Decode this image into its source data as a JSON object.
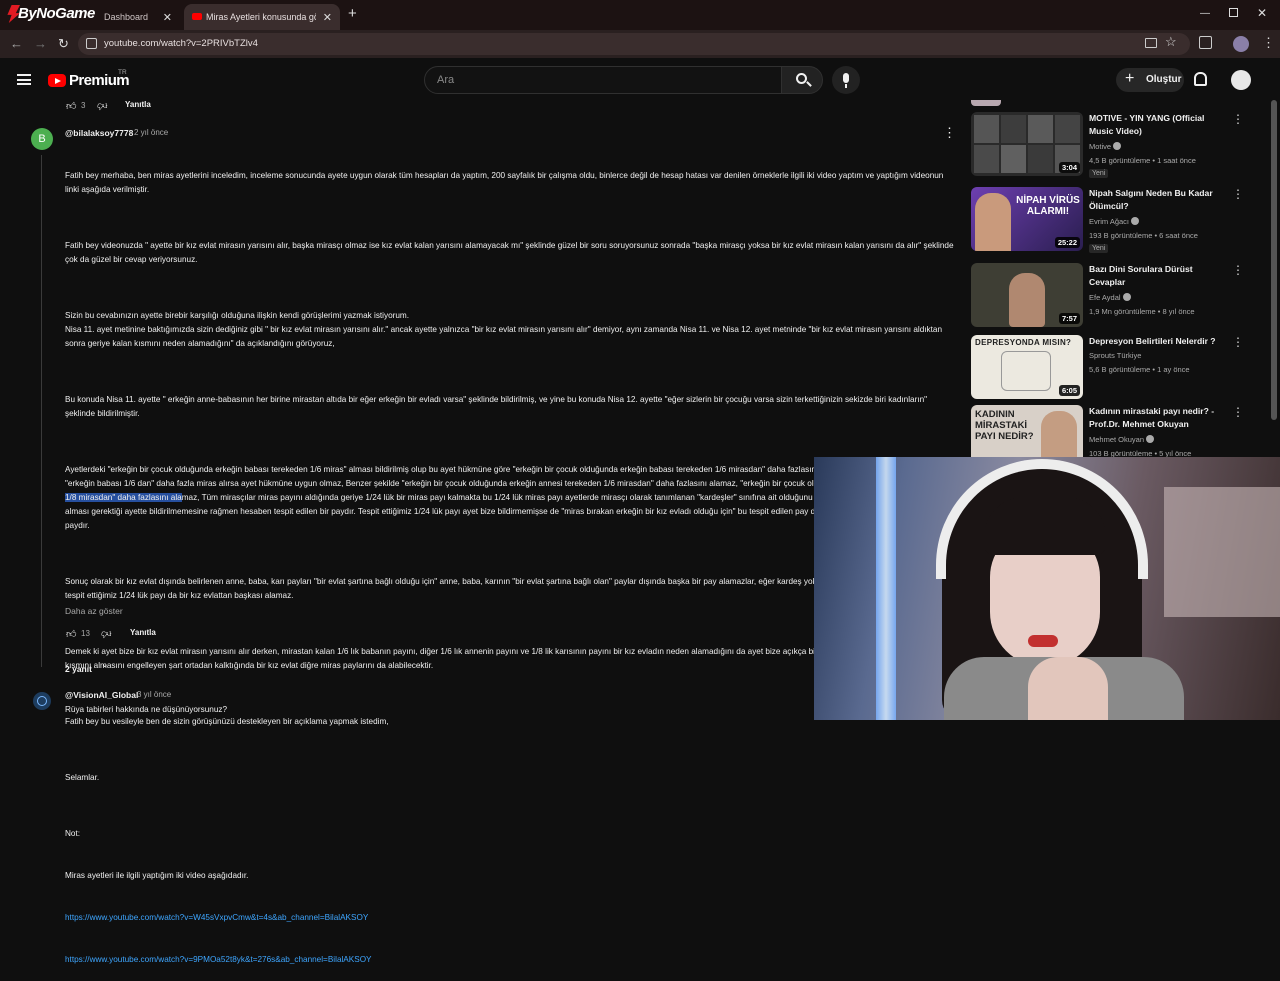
{
  "browser": {
    "brand": "ByNoGame",
    "tabs": [
      {
        "label": "Dashboard"
      },
      {
        "label": "Miras Ayetleri konusunda görüş"
      }
    ],
    "new_tab": "+",
    "url": "youtube.com/watch?v=2PRIVbTZlv4"
  },
  "youtube": {
    "logo": "Premium",
    "logo_sup": "TR",
    "search_placeholder": "Ara",
    "create_label": "Oluştur"
  },
  "prev_comment": {
    "likes": "3",
    "reply": "Yanıtla"
  },
  "comment": {
    "avatar_letter": "B",
    "author": "@bilalaksoy7778",
    "time": "2 yıl önce",
    "p1": "Fatih bey merhaba, ben miras ayetlerini inceledim, inceleme sonucunda ayete uygun olarak tüm hesapları da yaptım, 200 sayfalık bir çalışma oldu, binlerce değil de hesap hatası var denilen örneklerle ilgili iki video yaptım ve yaptığım videonun linki aşağıda verilmiştir.",
    "p2": "Fatih bey videonuzda \" ayette bir kız evlat mirasın yarısını alır, başka mirasçı olmaz ise kız evlat kalan yarısını alamayacak mı\" şeklinde güzel bir soru soruyorsunuz sonrada \"başka mirasçı yoksa bir kız evlat mirasın kalan yarısını da alır\" şeklinde çok da güzel bir cevap veriyorsunuz.",
    "p3": "Sizin bu cevabınızın ayette birebir karşılığı olduğuna ilişkin kendi görüşlerimi yazmak istiyorum.\nNisa 11. ayet metinine baktığımızda sizin dediğiniz gibi \" bir kız evlat mirasın yarısını alır.\" ancak ayette yalnızca \"bir kız evlat mirasın yarısını alır\" demiyor, aynı zamanda Nisa 11. ve Nisa 12. ayet metninde \"bir kız evlat mirasın yarısını aldıktan sonra geriye kalan kısmını neden alamadığını\" da açıklandığını görüyoruz,",
    "p4": "Bu konuda Nisa 11. ayette \" erkeğin anne-babasının her birine mirastan altıda bir eğer erkeğin bir evladı varsa\" şeklinde bildirilmiş, ve yine bu konuda Nisa 12. ayette \"eğer sizlerin bir çocuğu varsa sizin terkettiğinizin sekizde biri kadınların\" şeklinde bildirilmiştir.",
    "p5a": "Ayetlerdeki \"erkeğin bir çocuk olduğunda erkeğin babası terekeden 1/6 miras\" alması bildirilmiş olup bu ayet hükmüne göre \"erkeğin bir çocuk olduğunda erkeğin babası terekeden 1/6 mirasdan\" daha fazlasını alamadığını da anlıyoruz. Eğer \"erkeğin babası 1/6 dan\" daha fazla miras alırsa ayet hükmüne uygun olmaz, Benzer şekilde \"erkeğin bir çocuk olduğunda erkeğin annesi terekeden 1/6 mirasdan\" daha fazlasını alamaz, \"erkeğin bir çocuk olduğunda erkeğin kan",
    "p5hl": "sı da terekeden 1/8 mirasdan\" daha fazlasını ala",
    "p5b": "maz, Tüm mirasçılar miras payını aldığında geriye 1/24 lük bir miras payı kalmakta bu 1/24 lük miras payı ayetlerde mirasçı olarak tanımlanan \"kardeşler\" sınıfına ait olduğunu tespit ediyoruz. Bu 1/24 payı kimin alması gerektiği ayette bildirilmemesine rağmen hesaben tespit edilen bir paydır. Tespit ettiğimiz 1/24 lük payı ayet bize bildirmemişse de \"miras bırakan erkeğin bir kız evladı olduğu için\" bu tespit edilen pay da \"bir evlat olma şartına\" bağlı bir paydır.",
    "p6": "Sonuç olarak bir kız evlat dışında belirlenen anne, baba, karı payları \"bir evlat şartına bağlı olduğu için\" anne, baba, karının \"bir evlat şartına bağlı olan\" paylar dışında başka bir pay alamazlar, eğer kardeş yoksa kardeşe ait olduğunu hesaben tespit ettiğimiz 1/24 lük payı da bir kız evlattan başkası alamaz.",
    "p7": "Demek ki ayet bize bir kız evlat mirasın yarısını alır derken, mirastan kalan 1/6 lık babanın payını, diğer 1/6 lık annenin payını ve 1/8 lik karısının payını bir kız evladın neden alamadığını da ayet bize açıkça bildirmiştir. Bir kızın mirasın kalan kısmını almasını engelleyen şart ortadan kalktığında bir kız evlat diğre miras paylarını da alabilecektir.",
    "p8": "Fatih bey bu vesileyle ben de sizin görüşünüzü destekleyen bir açıklama yapmak istedim,",
    "p9": "Selamlar.",
    "p10a": "Not:",
    "p10b": "Miras ayetleri ile ilgili yaptığım iki video aşağıdadır.",
    "link1": "https://www.youtube.com/watch?v=W45sVxpvCmw&t=4s&ab_channel=BilalAKSOY",
    "link2": "https://www.youtube.com/watch?v=9PMOa52t8yk&t=276s&ab_channel=BilalAKSOY",
    "show_less": "Daha az göster",
    "likes": "13",
    "reply": "Yanıtla",
    "replies": "2 yanıt"
  },
  "next_comment": {
    "author": "@VisionAI_Global",
    "time": "3 yıl önce",
    "text": "Rüya tabirleri hakkında ne düşünüyorsunuz?"
  },
  "sidebar": [
    {
      "title": "MOTIVE - YIN YANG (Official Music Video)",
      "channel": "Motive",
      "meta": "4,5 B görüntüleme • 1 saat önce",
      "badge": "Yeni",
      "duration": "3:04",
      "thumb_color": "#2a2a2a"
    },
    {
      "title": "Nipah Salgını Neden Bu Kadar Ölümcül?",
      "channel": "Evrim Ağacı",
      "meta": "193 B görüntüleme • 6 saat önce",
      "badge": "Yeni",
      "duration": "25:22",
      "thumb_color": "#4a3a7a",
      "thumb_text": "NİPAH VİRÜS ALARMI!"
    },
    {
      "title": "Bazı Dini Sorulara Dürüst Cevaplar",
      "channel": "Efe Aydal",
      "meta": "1,9 Mn görüntüleme • 8 yıl önce",
      "duration": "7:57",
      "thumb_color": "#5a5a48"
    },
    {
      "title": "Depresyon Belirtileri Nelerdir ?",
      "channel": "Sprouts Türkiye",
      "meta": "5,6 B görüntüleme • 1 ay önce",
      "duration": "6:05",
      "thumb_color": "#ece9e0",
      "thumb_text": "DEPRESYONDA MISIN?"
    },
    {
      "title": "Kadının mirastaki payı nedir? - Prof.Dr. Mehmet Okuyan",
      "channel": "Mehmet Okuyan",
      "meta": "103 B görüntüleme • 5 yıl önce",
      "thumb_color": "#d8d0c8",
      "thumb_text": "KADININ MİRASTAKİ PAYI NEDİR?"
    }
  ]
}
